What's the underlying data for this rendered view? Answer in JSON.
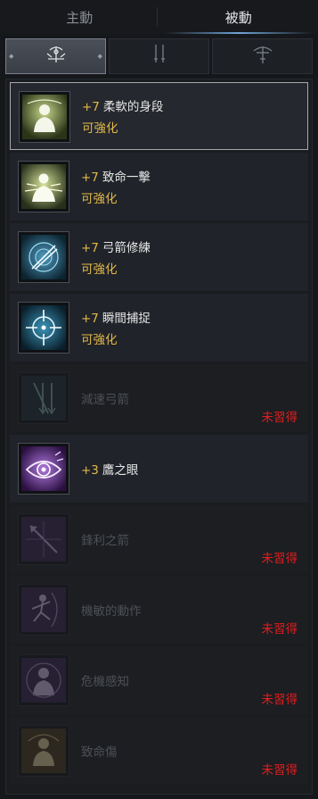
{
  "tabs": [
    {
      "label": "主動"
    },
    {
      "label": "被動"
    }
  ],
  "categories": [
    {
      "icon": "archer-emblem-icon"
    },
    {
      "icon": "dual-blades-icon"
    },
    {
      "icon": "crossbow-icon"
    }
  ],
  "skills": [
    {
      "icon": "flexible-body-icon",
      "level": "+7",
      "name": "柔軟的身段",
      "status": "可強化"
    },
    {
      "icon": "fatal-strike-icon",
      "level": "+7",
      "name": "致命一擊",
      "status": "可強化"
    },
    {
      "icon": "archery-training-icon",
      "level": "+7",
      "name": "弓箭修練",
      "status": "可強化"
    },
    {
      "icon": "moment-capture-icon",
      "level": "+7",
      "name": "瞬間捕捉",
      "status": "可強化"
    },
    {
      "icon": "slowing-arrow-icon",
      "name": "減速弓箭",
      "status": "未習得"
    },
    {
      "icon": "hawk-eye-icon",
      "level": "+3",
      "name": "鷹之眼"
    },
    {
      "icon": "sharp-arrow-icon",
      "name": "鋒利之箭",
      "status": "未習得"
    },
    {
      "icon": "agile-motion-icon",
      "name": "機敏的動作",
      "status": "未習得"
    },
    {
      "icon": "crisis-sense-icon",
      "name": "危機感知",
      "status": "未習得"
    },
    {
      "icon": "fatal-wound-icon",
      "name": "致命傷",
      "status": "未習得"
    }
  ]
}
